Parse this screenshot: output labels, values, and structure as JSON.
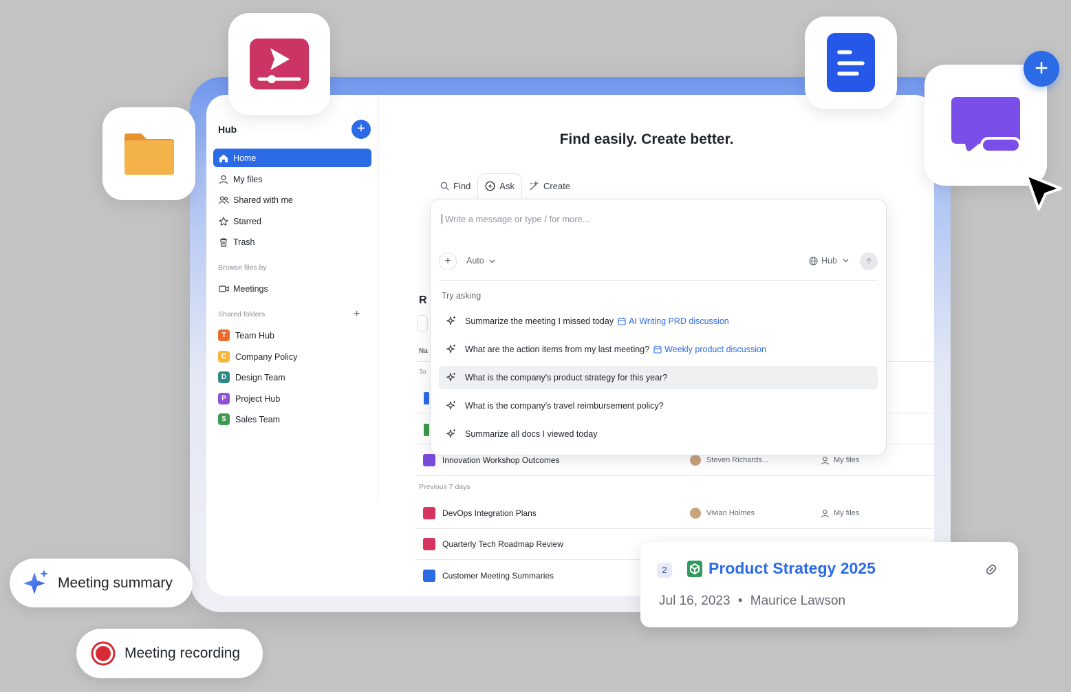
{
  "sidebar": {
    "title": "Hub",
    "add_label": "+",
    "nav": [
      {
        "label": "Home",
        "icon": "home-icon",
        "active": true
      },
      {
        "label": "My files",
        "icon": "user-icon"
      },
      {
        "label": "Shared with me",
        "icon": "users-icon"
      },
      {
        "label": "Starred",
        "icon": "star-icon"
      },
      {
        "label": "Trash",
        "icon": "trash-icon"
      }
    ],
    "browse_label": "Browse files by",
    "browse_items": [
      {
        "label": "Meetings",
        "icon": "video-icon"
      }
    ],
    "shared_folders_label": "Shared folders",
    "shared_folders_add": "+",
    "folders": [
      {
        "letter": "T",
        "label": "Team Hub",
        "color": "#ec6a2b"
      },
      {
        "letter": "C",
        "label": "Company Policy",
        "color": "#f5b83d"
      },
      {
        "letter": "D",
        "label": "Design Team",
        "color": "#2d8a86"
      },
      {
        "letter": "P",
        "label": "Project Hub",
        "color": "#8e4fd9"
      },
      {
        "letter": "S",
        "label": "Sales Team",
        "color": "#3d9a4f"
      }
    ]
  },
  "main": {
    "headline": "Find easily. Create better.",
    "tabs": [
      {
        "label": "Find",
        "icon": "search-icon"
      },
      {
        "label": "Ask",
        "icon": "ask-icon",
        "active": true
      },
      {
        "label": "Create",
        "icon": "wand-icon"
      }
    ],
    "ask": {
      "placeholder": "Write a message or type / for more...",
      "add": "+",
      "model": "Auto",
      "scope": "Hub",
      "try_label": "Try asking",
      "suggestions": [
        {
          "text": "Summarize the meeting I missed today",
          "ref": "AI Writing PRD discussion"
        },
        {
          "text": "What are the action items from my last meeting?",
          "ref": "Weekly product discussion"
        },
        {
          "text": "What is the company's product strategy for this year?",
          "ref": "",
          "highlighted": true
        },
        {
          "text": "What is the company's travel reimbursement policy?",
          "ref": ""
        },
        {
          "text": "Summarize all docs I viewed today",
          "ref": ""
        }
      ]
    },
    "recent_stub": "R",
    "name_stub": "Na",
    "today_stub": "To",
    "rows": [
      {
        "name": "Innovation Workshop Outcomes",
        "owner": "Steven Richards...",
        "location": "My files",
        "icon_color": "#7b4ce0"
      },
      {
        "name": "DevOps Integration Plans",
        "owner": "Vivian Holmes",
        "location": "My files",
        "icon_color": "#d6335f"
      },
      {
        "name": "Quarterly Tech Roadmap Review",
        "owner": "",
        "location": "",
        "icon_color": "#d6335f"
      },
      {
        "name": "Customer Meeting Summaries",
        "owner": "",
        "location": "",
        "icon_color": "#2c6be6"
      }
    ],
    "previous_label": "Previous 7 days"
  },
  "pills": {
    "meeting_summary": "Meeting summary",
    "meeting_recording": "Meeting recording"
  },
  "doc_card": {
    "number": "2",
    "title": "Product Strategy 2025",
    "date": "Jul 16, 2023",
    "separator": "•",
    "author": "Maurice Lawson"
  },
  "colors": {
    "accent": "#2c6be6",
    "background": "#c3c3c3",
    "record_red": "#d62b35"
  }
}
